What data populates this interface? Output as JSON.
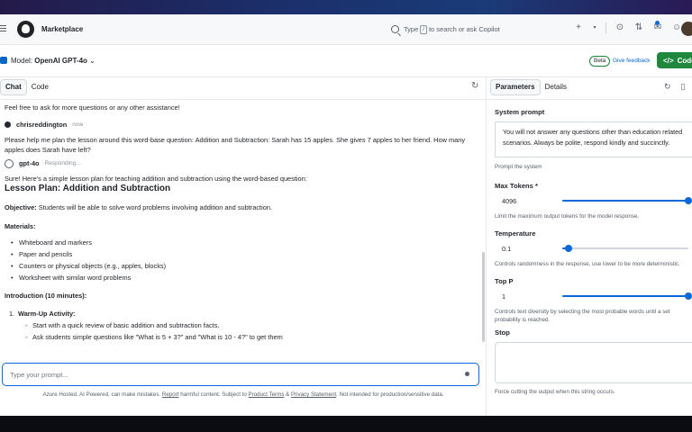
{
  "header": {
    "brand": "Marketplace",
    "search_placeholder_before": "Type",
    "search_key": "/",
    "search_placeholder_after": "to search or ask Copilot"
  },
  "modelbar": {
    "model_label": "Model:",
    "model_name": "OpenAI GPT-4o",
    "beta": "Beta",
    "feedback": "Give feedback",
    "code_button": "Code"
  },
  "left_tabs": {
    "chat": "Chat",
    "code": "Code"
  },
  "chat": {
    "intro": "Feel free to ask for more questions or any other assistance!",
    "user_name": "chrisreddington",
    "user_time": "now",
    "user_message": "Please help me plan the lesson around this word-base question: Addition and Subtraction: Sarah has 15 apples. She gives 7 apples to her friend. How many apples does Sarah have left?",
    "bot_name": "gpt-4o",
    "bot_status": "Responding...",
    "bot_intro": "Sure! Here's a simple lesson plan for teaching addition and subtraction using the word-based question:",
    "lesson_title": "Lesson Plan: Addition and Subtraction",
    "objective_label": "Objective:",
    "objective_text": " Students will be able to solve word problems involving addition and subtraction.",
    "materials_label": "Materials:",
    "materials": [
      "Whiteboard and markers",
      "Paper and pencils",
      "Counters or physical objects (e.g., apples, blocks)",
      "Worksheet with similar word problems"
    ],
    "intro_section": "Introduction (10 minutes):",
    "warmup_label": "Warm-Up Activity:",
    "warmup_items": [
      "Start with a quick review of basic addition and subtraction facts.",
      "Ask students simple questions like \"What is 5 + 3?\" and \"What is 10 - 4?\" to get them"
    ]
  },
  "prompt_placeholder": "Type your prompt...",
  "disclaimer": {
    "part1": "Azure Hosted. AI Powered, can make mistakes.",
    "report": "Report",
    "part2": "harmful content. Subject to",
    "terms": "Product Terms",
    "amp": "&",
    "privacy": "Privacy Statement",
    "part3": ". Not intended for production/sensitive data."
  },
  "right_tabs": {
    "parameters": "Parameters",
    "details": "Details"
  },
  "params": {
    "system_prompt_label": "System prompt",
    "system_prompt_text": "You will not answer any questions other than education related scenarios. Always be polite, respond kindly and succinctly.",
    "system_prompt_hint": "Prompt the system",
    "max_tokens_label": "Max Tokens *",
    "max_tokens_value": "4096",
    "max_tokens_fraction": 1.0,
    "max_tokens_hint": "Limit the maximum output tokens for the model response.",
    "temperature_label": "Temperature",
    "temperature_value": "0.1",
    "temperature_fraction": 0.05,
    "temperature_hint": "Controls randomness in the response, use lower to be more deterministic.",
    "top_p_label": "Top P",
    "top_p_value": "1",
    "top_p_fraction": 1.0,
    "top_p_hint": "Controls text diversity by selecting the most probable words until a set probability is reached.",
    "stop_label": "Stop",
    "stop_hint": "Force cutting the output when this string occurs."
  },
  "colors": {
    "accent": "#0969da",
    "code_button": "#1f883d"
  }
}
